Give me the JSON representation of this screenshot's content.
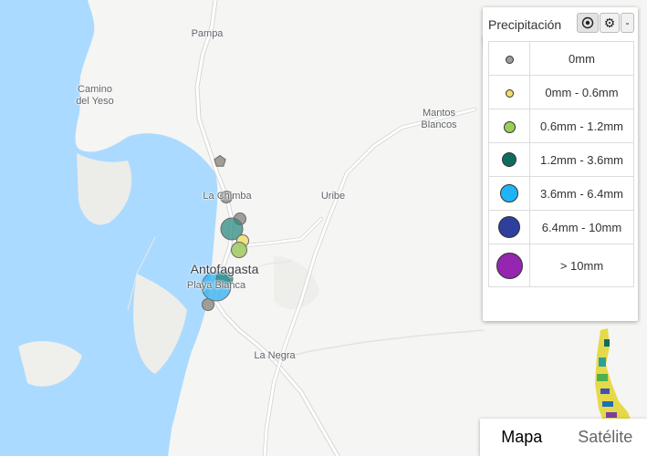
{
  "map": {
    "places": [
      {
        "name": "Pampa"
      },
      {
        "name": "Camino del Yeso"
      },
      {
        "name": "Mantos Blancos"
      },
      {
        "name": "La Chimba"
      },
      {
        "name": "Uribe"
      },
      {
        "name": "Antofagasta"
      },
      {
        "name": "Playa Blanca"
      },
      {
        "name": "La Negra"
      }
    ],
    "markers": [
      {
        "category": "0mm",
        "color": "#9a9a92"
      },
      {
        "category": "0mm",
        "color": "#9a9a92"
      },
      {
        "category": "0mm",
        "color": "#9a9a92"
      },
      {
        "category": "0mm",
        "color": "#9a9a92"
      },
      {
        "category": "1.2mm - 3.6mm",
        "color": "#2e8a82"
      },
      {
        "category": "0mm - 0.6mm",
        "color": "#f0e27a"
      },
      {
        "category": "0.6mm - 1.2mm",
        "color": "#a5cf6e"
      },
      {
        "category": "3.6mm - 6.4mm",
        "color": "#3ab4f2"
      },
      {
        "category": "1.2mm - 3.6mm",
        "color": "#2e8a82"
      }
    ],
    "colors": {
      "water": "#aadaff",
      "land": "#f5f5f3",
      "road": "#ffffff",
      "road_outline": "#d6d6d6"
    }
  },
  "legend": {
    "title": "Precipitación",
    "minimize_label": "-",
    "items": [
      {
        "label": "0mm",
        "color": "#9e9e96"
      },
      {
        "label": "0mm - 0.6mm",
        "color": "#f4dc6a"
      },
      {
        "label": "0.6mm - 1.2mm",
        "color": "#9ccc5a"
      },
      {
        "label": "1.2mm - 3.6mm",
        "color": "#0f6b5e"
      },
      {
        "label": "3.6mm - 6.4mm",
        "color": "#1fb4f5"
      },
      {
        "label": "6.4mm - 10mm",
        "color": "#2e3f9e"
      },
      {
        "label": "> 10mm",
        "color": "#9426b0"
      }
    ]
  },
  "map_type": {
    "map_label": "Mapa",
    "satellite_label": "Satélite"
  }
}
